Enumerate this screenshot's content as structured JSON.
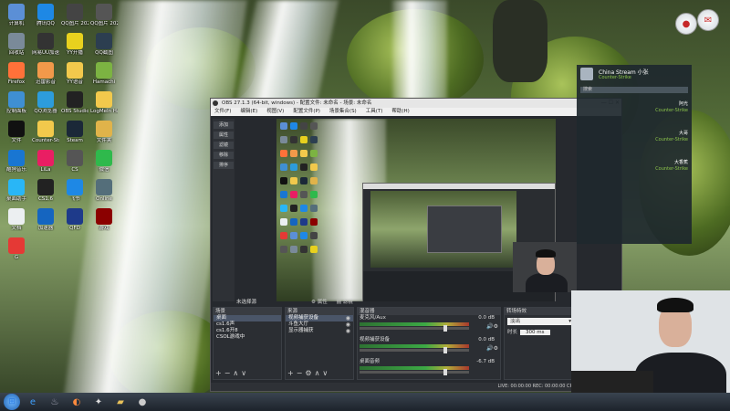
{
  "desktop_icons": [
    {
      "label": "计算机",
      "icon": "computer-icon",
      "color": "#5b8fd6"
    },
    {
      "label": "腾讯QQ",
      "icon": "qq-icon",
      "color": "#1e88e5"
    },
    {
      "label": "QQ图片 20211212",
      "icon": "image-icon",
      "color": "#444444"
    },
    {
      "label": "QQ图片 20211213",
      "icon": "image-icon",
      "color": "#555555"
    },
    {
      "label": "回收站",
      "icon": "recycle-bin-icon",
      "color": "#7a8a99"
    },
    {
      "label": "网易UU加速器",
      "icon": "uu-accelerator-icon",
      "color": "#333333"
    },
    {
      "label": "YY开播",
      "icon": "yy-icon",
      "color": "#e8d11e"
    },
    {
      "label": "QQ截图",
      "icon": "screenshot-icon",
      "color": "#2c3e50"
    },
    {
      "label": "Firefox",
      "icon": "firefox-icon",
      "color": "#ff7139"
    },
    {
      "label": "迅雷影音",
      "icon": "player-icon",
      "color": "#f2994a"
    },
    {
      "label": "YY语音",
      "icon": "yy-voice-icon",
      "color": "#f2c94c"
    },
    {
      "label": "Hamachi",
      "icon": "hamachi-icon",
      "color": "#7cb342"
    },
    {
      "label": "控制面板",
      "icon": "control-panel-icon",
      "color": "#3f8fd2"
    },
    {
      "label": "QQ浏览器",
      "icon": "browser-icon",
      "color": "#2d9cdb"
    },
    {
      "label": "OBS Studio",
      "icon": "obs-icon",
      "color": "#222222"
    },
    {
      "label": "LogMeIn Hamachi",
      "icon": "logmein-icon",
      "color": "#f2c94c"
    },
    {
      "label": "文件",
      "icon": "file-icon",
      "color": "#111111"
    },
    {
      "label": "Counter-Strike",
      "icon": "folder-icon",
      "color": "#f2c94c"
    },
    {
      "label": "Steam",
      "icon": "steam-icon",
      "color": "#1b2838"
    },
    {
      "label": "文件夹",
      "icon": "folder-icon",
      "color": "#e0b34a"
    },
    {
      "label": "酷狗音乐",
      "icon": "kugou-icon",
      "color": "#1976d2"
    },
    {
      "label": "LiLa",
      "icon": "lila-icon",
      "color": "#e91e63"
    },
    {
      "label": "CS",
      "icon": "cs-icon",
      "color": "#555555"
    },
    {
      "label": "微信",
      "icon": "wechat-icon",
      "color": "#2fb94c"
    },
    {
      "label": "桌面助手",
      "icon": "assistant-icon",
      "color": "#29b6f6"
    },
    {
      "label": "CS1.6",
      "icon": "cs16-icon",
      "color": "#222222"
    },
    {
      "label": "飞书",
      "icon": "feishu-icon",
      "color": "#1e88e5"
    },
    {
      "label": "Online",
      "icon": "online-icon",
      "color": "#546e7a"
    },
    {
      "label": "文档",
      "icon": "document-icon",
      "color": "#eceff1"
    },
    {
      "label": "加速器",
      "icon": "accelerator-icon",
      "color": "#1565c0"
    },
    {
      "label": "QFD",
      "icon": "qfd-icon",
      "color": "#1e3a8a"
    },
    {
      "label": "游戏",
      "icon": "game-icon",
      "color": "#8b0000"
    },
    {
      "label": "G",
      "icon": "g-icon",
      "color": "#e53935"
    }
  ],
  "obs": {
    "title": "OBS 27.1.3 (64-bit, windows) - 配置文件: 未命名 - 场景: 未命名",
    "menu": [
      "文件(F)",
      "编辑(E)",
      "视图(V)",
      "配置文件(P)",
      "场景集合(S)",
      "工具(T)",
      "帮助(H)"
    ],
    "left_buttons": [
      "添加",
      "属性",
      "滤镜",
      "移除",
      "排序"
    ],
    "unselected_label": "未选择源",
    "toolbar": [
      "属性",
      "滤镜"
    ],
    "scenes": {
      "title": "场景",
      "items": [
        "桌面",
        "cs1.6声",
        "cs1.6开8",
        "CSOL游戏中"
      ]
    },
    "sources": {
      "title": "来源",
      "items": [
        "视频捕获设备",
        "斗鱼大厅",
        "显示器捕获"
      ]
    },
    "mixer": {
      "title": "混音器",
      "channels": [
        {
          "name": "麦克风/Aux",
          "db": "0.0 dB"
        },
        {
          "name": "视频捕获设备",
          "db": "0.0 dB"
        },
        {
          "name": "桌面音频",
          "db": "-6.7 dB"
        }
      ]
    },
    "transitions": {
      "title": "转场特效",
      "selected": "淡出",
      "duration_label": "时长",
      "duration_value": "300 ms"
    },
    "statusbar": "LIVE: 00:00:00  REC: 00:00:00  CPU: 21.3%, 30.00 fps"
  },
  "chat": {
    "name": "China Stream 小张",
    "game": "Counter-Strike",
    "search": "搜索",
    "list": [
      {
        "text": "阿光",
        "green": false
      },
      {
        "text": "Counter-Strike",
        "green": true
      },
      {
        "text": "大哥",
        "green": false
      },
      {
        "text": "Counter-Strike",
        "green": true
      },
      {
        "text": "大香蕉",
        "green": false
      },
      {
        "text": "Counter-Strike",
        "green": true
      }
    ]
  },
  "taskbar": {
    "items": [
      {
        "icon": "start-icon"
      },
      {
        "icon": "ie-icon"
      },
      {
        "icon": "steam-icon"
      },
      {
        "icon": "firefox-icon"
      },
      {
        "icon": "cs-icon"
      },
      {
        "icon": "folder-icon"
      },
      {
        "icon": "obs-icon"
      }
    ]
  }
}
